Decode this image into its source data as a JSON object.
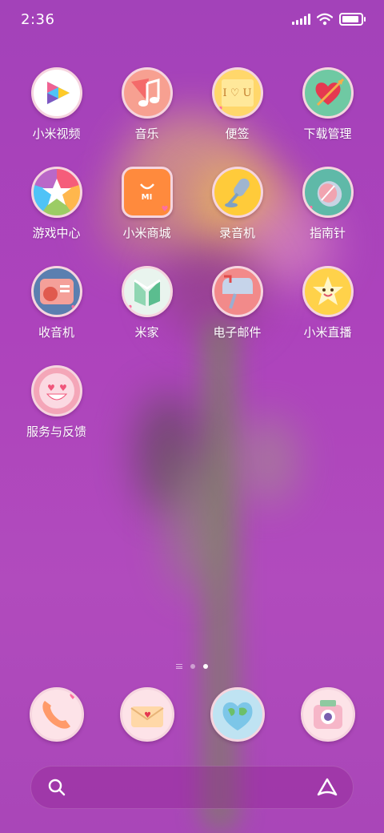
{
  "status_bar": {
    "time": "2:36"
  },
  "apps": [
    {
      "label": "小米视频"
    },
    {
      "label": "音乐"
    },
    {
      "label": "便签"
    },
    {
      "label": "下载管理"
    },
    {
      "label": "游戏中心"
    },
    {
      "label": "小米商城"
    },
    {
      "label": "录音机"
    },
    {
      "label": "指南针"
    },
    {
      "label": "收音机"
    },
    {
      "label": "米家"
    },
    {
      "label": "电子邮件"
    },
    {
      "label": "小米直播"
    },
    {
      "label": "服务与反馈"
    }
  ],
  "icons": {
    "video": "play-icon",
    "music": "music-note-icon",
    "notes": "sticky-note-icon",
    "downloads": "heart-arrow-icon",
    "game": "star-icon",
    "mall": "shopping-bag-icon",
    "recorder": "microphone-icon",
    "compass": "compass-icon",
    "radio": "radio-icon",
    "mijia": "mijia-icon",
    "email": "mailbox-icon",
    "live": "star-face-icon",
    "service": "smiley-face-icon"
  },
  "notes_text": "I ♡ U",
  "mall_text": "MI",
  "page_indicator": {
    "pages": 2,
    "current": 2
  },
  "dock": [
    {
      "name": "phone-app",
      "icon": "phone-icon"
    },
    {
      "name": "messages-app",
      "icon": "envelope-icon"
    },
    {
      "name": "browser-app",
      "icon": "globe-icon"
    },
    {
      "name": "camera-app",
      "icon": "camera-icon"
    }
  ],
  "colors": {
    "background": "#a843bb",
    "icon_ring": "#f6d5df",
    "heart": "#ff6fa0"
  }
}
